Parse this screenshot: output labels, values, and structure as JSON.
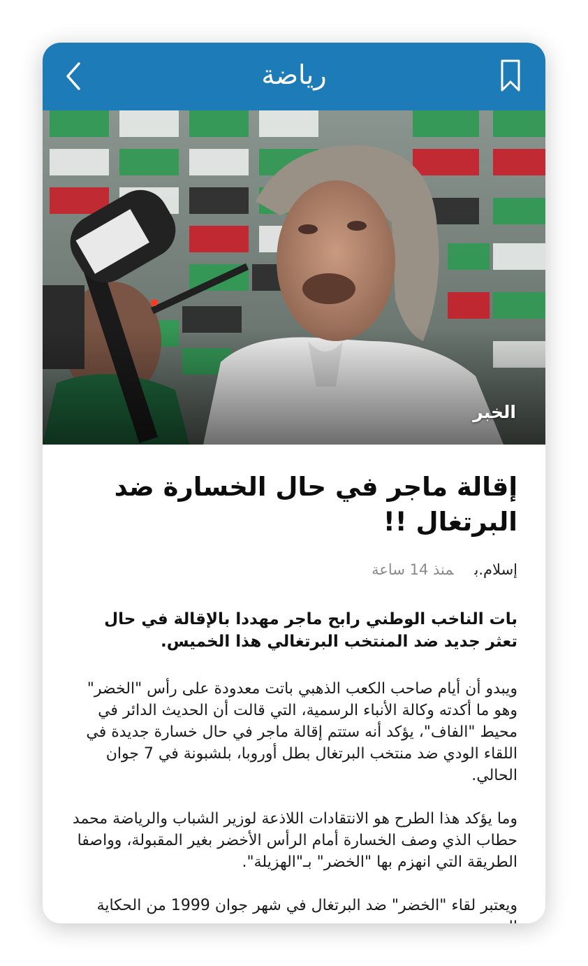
{
  "header": {
    "title": "رياضة",
    "back_icon": "chevron-left-icon",
    "bookmark_icon": "bookmark-icon",
    "color": "#1d7bb7"
  },
  "hero": {
    "source_label": "الخبر"
  },
  "article": {
    "title": "إقالة ماجر في حال الخسارة ضد البرتغال !!",
    "author": "إسلام.ب",
    "time": "منذ 14 ساعة",
    "lead": "بات الناخب الوطني رابح ماجر مهددا بالإقالة في حال تعثر جديد ضد المنتخب البرتغالي هذا الخميس.",
    "paragraphs": [
      "ويبدو أن أيام صاحب الكعب الذهبي باتت معدودة على رأس \"الخضر\" وهو ما أكدته وكالة الأنباء الرسمية، التي قالت أن الحديث الدائر في محيط \"الفاف\"، يؤكد أنه ستتم إقالة ماجر في حال خسارة جديدة في اللقاء الودي ضد منتخب البرتغال بطل أوروبا، بلشبونة في 7 جوان الحالي.",
      "وما يؤكد هذا الطرح هو الانتقادات اللاذعة لوزير الشباب والرياضة محمد حطاب الذي وصف الخسارة أمام الرأس الأخضر بغير المقبولة، وواصفا الطريقة التي انهزم بها \"الخضر\" بـ\"الهزيلة\".",
      "ويعتبر لقاء \"الخضر\" ضد البرتغال في شهر جوان 1999 من الحكاية التي"
    ]
  }
}
